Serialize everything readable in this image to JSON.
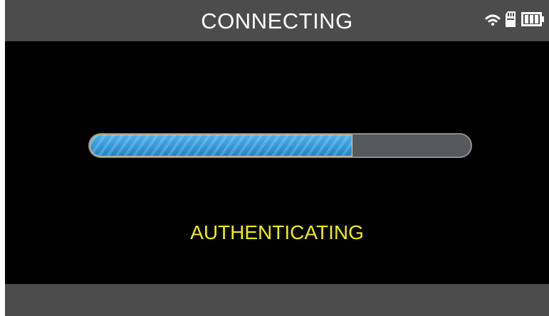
{
  "header": {
    "title": "CONNECTING",
    "icons": [
      "wifi-icon",
      "sd-card-icon",
      "battery-icon"
    ]
  },
  "progress": {
    "fraction": 0.69
  },
  "status": {
    "message": "AUTHENTICATING",
    "color": "#f2ea12"
  },
  "colors": {
    "bar_bg": "#4c4c4c",
    "screen_bg": "#000000",
    "progress_fill": "#2b8fd6",
    "progress_track": "#56595e"
  }
}
